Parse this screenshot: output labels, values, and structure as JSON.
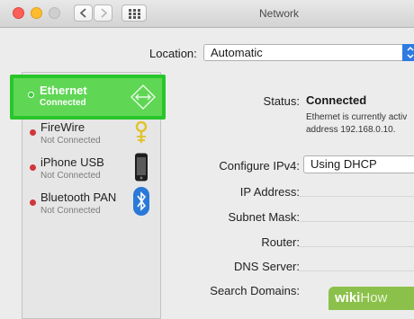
{
  "window": {
    "title": "Network"
  },
  "location": {
    "label": "Location:",
    "value": "Automatic"
  },
  "services": [
    {
      "name": "Ethernet",
      "status": "Connected",
      "icon": "ethernet-arrows-icon"
    },
    {
      "name": "FireWire",
      "status": "Not Connected",
      "icon": "firewire-icon"
    },
    {
      "name": "iPhone USB",
      "status": "Not Connected",
      "icon": "iphone-icon"
    },
    {
      "name": "Bluetooth PAN",
      "status": "Not Connected",
      "icon": "bluetooth-icon"
    }
  ],
  "details": {
    "status_label": "Status:",
    "status_value": "Connected",
    "status_desc_line1": "Ethernet is currently activ",
    "status_desc_line2": "address 192.168.0.10.",
    "configure_label": "Configure IPv4:",
    "configure_value": "Using DHCP",
    "ip_label": "IP Address:",
    "subnet_label": "Subnet Mask:",
    "router_label": "Router:",
    "dns_label": "DNS Server:",
    "search_label": "Search Domains:"
  },
  "watermark": {
    "part1": "wiki",
    "part2": "How"
  },
  "colors": {
    "highlight": "#5fd654",
    "highlight_border": "#28c62a",
    "disconnected": "#d0373b",
    "accent": "#2d7be2"
  }
}
